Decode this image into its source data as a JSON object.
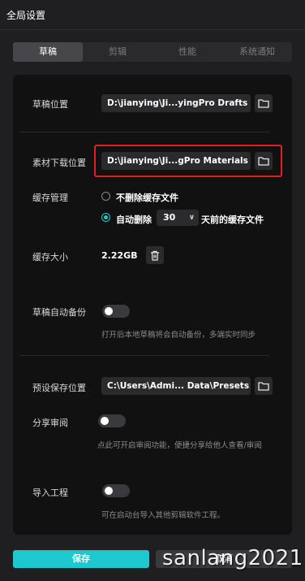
{
  "window": {
    "title": "全局设置"
  },
  "tabs": [
    {
      "label": "草稿",
      "active": true
    },
    {
      "label": "剪辑",
      "active": false
    },
    {
      "label": "性能",
      "active": false
    },
    {
      "label": "系统通知",
      "active": false
    }
  ],
  "draft_location": {
    "label": "草稿位置",
    "value": "D:\\jianying\\Ji...yingPro Drafts"
  },
  "material_download": {
    "label": "素材下载位置",
    "value": "D:\\jianying\\Ji...gPro Materials"
  },
  "cache_management": {
    "label": "缓存管理",
    "option_keep": "不删除缓存文件",
    "option_auto_prefix": "自动删除",
    "days_value": "30",
    "option_auto_suffix": "天前的缓存文件",
    "selected": "auto"
  },
  "cache_size": {
    "label": "缓存大小",
    "value": "2.22GB"
  },
  "auto_backup": {
    "label": "草稿自动备份",
    "hint": "打开后本地草稿将会自动备份，多端实时同步",
    "enabled": false
  },
  "preset_location": {
    "label": "预设保存位置",
    "value": "C:\\Users\\Admi... Data\\Presets"
  },
  "share_review": {
    "label": "分享审阅",
    "hint": "点此可开启审阅功能，便捷分享给他人查看/审阅",
    "enabled": false
  },
  "import_project": {
    "label": "导入工程",
    "hint": "可在启动台导入其他剪辑软件工程。",
    "enabled": false
  },
  "footer": {
    "save_label": "保存",
    "cancel_label": "取消"
  },
  "watermark": "sanlang2021",
  "colors": {
    "accent": "#1ec8cf",
    "highlight": "#e0211f",
    "panel": "#111112",
    "background": "#1f1f21"
  },
  "icons": {
    "folder": "folder-icon",
    "trash": "trash-icon",
    "chevron": "chevron-down-icon"
  }
}
